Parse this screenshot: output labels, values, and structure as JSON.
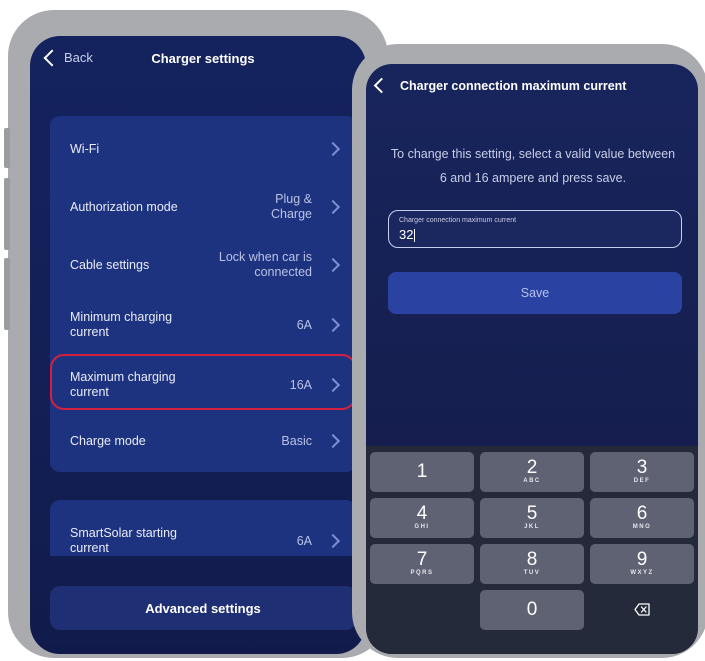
{
  "screen1": {
    "back_label": "Back",
    "title": "Charger settings",
    "rows": [
      {
        "label": "Wi-Fi",
        "value": ""
      },
      {
        "label": "Authorization mode",
        "value": "Plug & Charge"
      },
      {
        "label": "Cable settings",
        "value": "Lock when car is connected"
      },
      {
        "label": "Minimum charging current",
        "value": "6A"
      },
      {
        "label": "Maximum charging current",
        "value": "16A"
      },
      {
        "label": "Charge mode",
        "value": "Basic"
      }
    ],
    "smart_row": {
      "label": "SmartSolar starting current",
      "value": "6A"
    },
    "advanced_button": "Advanced settings",
    "highlight_color": "#d6203f"
  },
  "screen2": {
    "title": "Charger connection maximum current",
    "instruction": "To change this setting, select a valid value between 6 and 16 ampere and press save.",
    "field_label": "Charger connection maximum current",
    "field_value": "32",
    "save_label": "Save",
    "keypad": [
      {
        "num": "1",
        "letters": ""
      },
      {
        "num": "2",
        "letters": "ABC"
      },
      {
        "num": "3",
        "letters": "DEF"
      },
      {
        "num": "4",
        "letters": "GHI"
      },
      {
        "num": "5",
        "letters": "JKL"
      },
      {
        "num": "6",
        "letters": "MNO"
      },
      {
        "num": "7",
        "letters": "PQRS"
      },
      {
        "num": "8",
        "letters": "TUV"
      },
      {
        "num": "9",
        "letters": "WXYZ"
      },
      {
        "num": "0",
        "letters": ""
      }
    ],
    "delete_icon": "backspace-icon"
  }
}
